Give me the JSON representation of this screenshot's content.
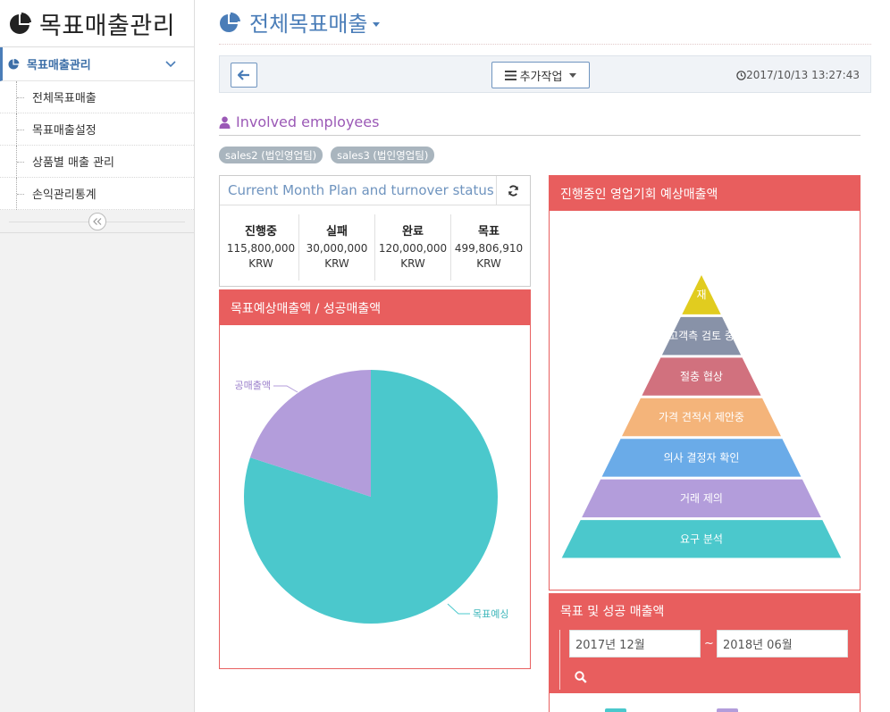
{
  "sidebar": {
    "title": "목표매출관리",
    "active_item": "목표매출관리",
    "sub_items": [
      "전체목표매출",
      "목표매출설정",
      "상품별 매출 관리",
      "손익관리통계"
    ]
  },
  "header": {
    "title": "전체목표매출"
  },
  "toolbar": {
    "more_label": "추가작업",
    "timestamp": "2017/10/13 13:27:43"
  },
  "involved": {
    "label": "Involved employees",
    "tags": [
      "sales2 (법인영업팀)",
      "sales3 (법인영업팀)"
    ]
  },
  "status": {
    "title": "Current Month Plan and turnover status",
    "columns": [
      {
        "label": "진행중",
        "value": "115,800,000",
        "unit": "KRW"
      },
      {
        "label": "실패",
        "value": "30,000,000",
        "unit": "KRW"
      },
      {
        "label": "완료",
        "value": "120,000,000",
        "unit": "KRW"
      },
      {
        "label": "목표",
        "value": "499,806,910",
        "unit": "KRW"
      }
    ]
  },
  "pie_panel": {
    "title": "목표예상매출액 / 성공매출액",
    "label_success": "공매출액",
    "label_target": "목표예싱"
  },
  "funnel_panel": {
    "title": "진행중인 영업기회 예상매출액",
    "stages": [
      "재",
      "고객측 검토 중",
      "절충 협상",
      "가격 견적서 제안중",
      "의사 결정자 확인",
      "거래 제의",
      "요구 분석"
    ]
  },
  "target_panel": {
    "title": "목표 및 성공 매출액",
    "date_from": "2017년 12월",
    "date_to": "2018년 06월",
    "tilde": "~"
  },
  "colors": {
    "accent_blue": "#4a7db8",
    "panel_red": "#e85e5e",
    "pie_target": "#4bc8cc",
    "pie_success": "#b39ddb",
    "funnel": [
      "#e1cc1f",
      "#8892a8",
      "#d1717e",
      "#f4b47a",
      "#6aabe8",
      "#b39ddb",
      "#4bc8cc"
    ]
  },
  "chart_data": [
    {
      "type": "pie",
      "labels": [
        "목표예상매출액",
        "성공매출액"
      ],
      "values": [
        80,
        20
      ]
    },
    {
      "type": "funnel",
      "categories": [
        "재",
        "고객측 검토 중",
        "절충 협상",
        "가격 견적서 제안중",
        "의사 결정자 확인",
        "거래 제의",
        "요구 분석"
      ]
    }
  ]
}
